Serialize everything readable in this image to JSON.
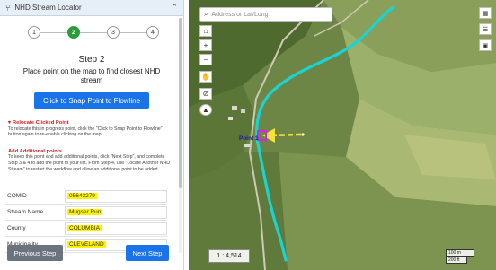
{
  "header": {
    "title": "NHD Stream Locator"
  },
  "steps": [
    "1",
    "2",
    "3",
    "4"
  ],
  "current_step": 2,
  "step_title": "Step 2",
  "instruction": "Place point on the map to find closest NHD stream",
  "snap_button": "Click to Snap Point to Flowline",
  "note1": {
    "title": "Relocate Clicked Point",
    "text": "To relocate this in progress point, click the \"Click to Snap Point to Flowline\" button again to re-enable clicking on the map."
  },
  "note2": {
    "title": "Add Additional points",
    "text": "To keep this point and add additional points, click \"Next Step\", and complete Step 3 & 4 to add the point to your list. From Step 4, use \"Locate Another NHD Stream\" to restart the workflow and allow an additional point to be added."
  },
  "fields": [
    {
      "label": "COMID",
      "value": "05643279"
    },
    {
      "label": "Stream Name",
      "value": "Mugser Run"
    },
    {
      "label": "County",
      "value": "COLUMBIA"
    },
    {
      "label": "Municipality",
      "value": "CLEVELAND"
    }
  ],
  "buttons": {
    "previous": "Previous Step",
    "next": "Next Step"
  },
  "map": {
    "search_placeholder": "Address or Lat/Long",
    "point_label": "Point 1",
    "scale_ratio": "1 : 4,514",
    "scalebar_1": "100 m",
    "scalebar_2": "200 ft",
    "stream_color": "#19d4d4",
    "arrow_color": "#f2e23a",
    "point_color": "#d12ad1"
  },
  "icons": {
    "header": "stream-logo-icon",
    "collapse": "chevron-up-icon",
    "search": "search-icon",
    "zoom_in": "plus-icon",
    "zoom_out": "minus-icon",
    "pan": "hand-icon",
    "erase": "eraser-icon",
    "compass": "compass-icon",
    "right": [
      "basemap-icon",
      "layers-icon",
      "legend-icon"
    ]
  }
}
